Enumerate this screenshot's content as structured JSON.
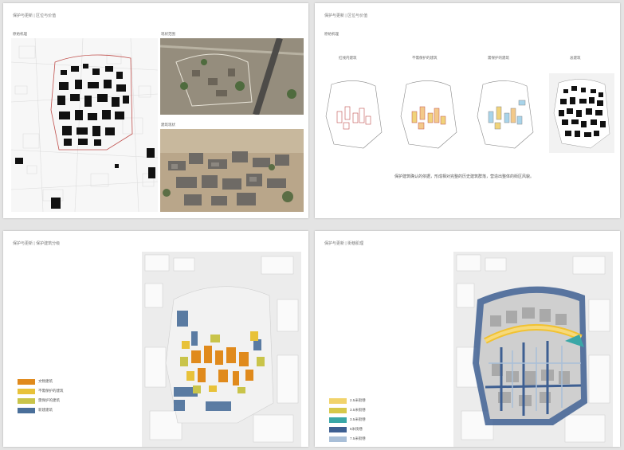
{
  "page1": {
    "header": "保护与更新 | 区位与价值",
    "figure_labels": [
      "原始机理",
      "现状范围",
      "建筑现状"
    ]
  },
  "page2": {
    "header": "保护与更新 | 区位与价值",
    "section_label": "原始机理",
    "diagram_labels": [
      "红线内建筑",
      "不需保护的建筑",
      "需保护的建筑",
      "总建筑"
    ],
    "note": "保护建筑确认的依据，形成相对完整的历史建筑群落，营造出整体的街区风貌。"
  },
  "page3": {
    "header": "保护与更新 | 保护建筑分级",
    "legend": [
      {
        "label": "文物建筑",
        "color": "#e08a1c"
      },
      {
        "label": "不需保护的建筑",
        "color": "#e8c23a"
      },
      {
        "label": "需保护的建筑",
        "color": "#c9c44a"
      },
      {
        "label": "新建建筑",
        "color": "#4a6f9a"
      }
    ]
  },
  "page4": {
    "header": "保护与更新 | 街巷肌理",
    "legend": [
      {
        "label": "2.5米街巷",
        "color": "#f1d36b"
      },
      {
        "label": "3.5米街巷",
        "color": "#d6c84a"
      },
      {
        "label": "3.5米街巷",
        "color": "#3aa7a7"
      },
      {
        "label": "6米街巷",
        "color": "#3e5f92"
      },
      {
        "label": "7.5米街巷",
        "color": "#a9bfd8"
      }
    ]
  }
}
